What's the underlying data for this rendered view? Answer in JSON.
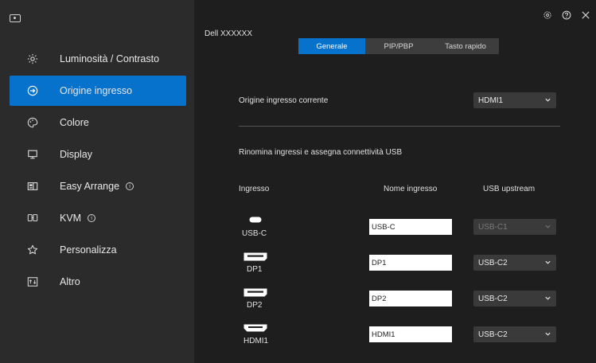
{
  "app": {
    "window_title": "Dell XXXXXX",
    "controls": [
      {
        "name": "settings-icon"
      },
      {
        "name": "help-icon"
      },
      {
        "name": "close-icon"
      }
    ]
  },
  "sidebar": {
    "items": [
      {
        "id": "brightness",
        "label": "Luminosità / Contrasto",
        "icon": "sun-icon",
        "active": false
      },
      {
        "id": "input-source",
        "label": "Origine ingresso",
        "icon": "input-icon",
        "active": true
      },
      {
        "id": "color",
        "label": "Colore",
        "icon": "palette-icon",
        "active": false
      },
      {
        "id": "display",
        "label": "Display",
        "icon": "monitor-icon",
        "active": false
      },
      {
        "id": "easy-arrange",
        "label": "Easy Arrange",
        "icon": "layout-icon",
        "active": false,
        "info": true
      },
      {
        "id": "kvm",
        "label": "KVM",
        "icon": "kvm-icon",
        "active": false,
        "info": true
      },
      {
        "id": "personalize",
        "label": "Personalizza",
        "icon": "star-icon",
        "active": false
      },
      {
        "id": "other",
        "label": "Altro",
        "icon": "other-icon",
        "active": false
      }
    ]
  },
  "tabs": [
    {
      "label": "Generale",
      "active": true
    },
    {
      "label": "PIP/PBP",
      "active": false
    },
    {
      "label": "Tasto rapido",
      "active": false
    }
  ],
  "current_input": {
    "label": "Origine ingresso corrente",
    "value": "HDMI1"
  },
  "section_title": "Rinomina ingressi e assegna connettività USB",
  "columns": {
    "input": "Ingresso",
    "name": "Nome ingresso",
    "usb": "USB upstream"
  },
  "ports": [
    {
      "label": "USB-C",
      "icon": "usb-c-port-icon",
      "name_value": "USB-C",
      "usb": "USB-C1",
      "usb_disabled": true
    },
    {
      "label": "DP1",
      "icon": "displayport-icon",
      "name_value": "DP1",
      "usb": "USB-C2",
      "usb_disabled": false
    },
    {
      "label": "DP2",
      "icon": "displayport-icon",
      "name_value": "DP2",
      "usb": "USB-C2",
      "usb_disabled": false
    },
    {
      "label": "HDMI1",
      "icon": "hdmi-port-icon",
      "name_value": "HDMI1",
      "usb": "USB-C2",
      "usb_disabled": false
    }
  ],
  "colors": {
    "accent": "#0672cb",
    "sidebar_bg": "#2b2b2b",
    "main_bg": "#1e1e1e"
  }
}
